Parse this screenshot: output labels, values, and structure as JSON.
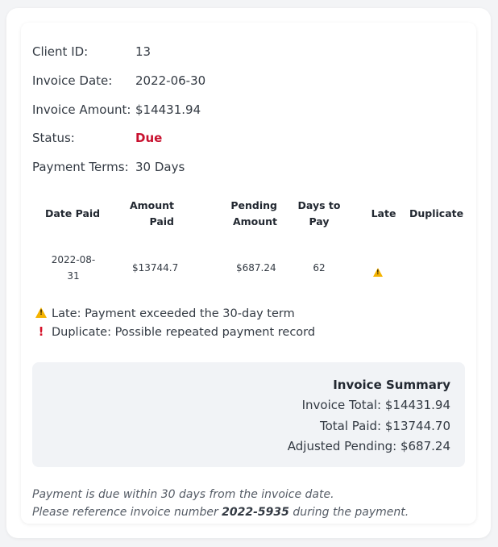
{
  "client": {
    "label": "Client ID:",
    "value": "13"
  },
  "invoice_date": {
    "label": "Invoice Date:",
    "value": "2022-06-30"
  },
  "invoice_amount": {
    "label": "Invoice Amount:",
    "value": "$14431.94"
  },
  "status": {
    "label": "Status:",
    "value": "Due",
    "color": "#c8102e"
  },
  "payment_terms": {
    "label": "Payment Terms:",
    "value": "30 Days"
  },
  "table": {
    "headers": {
      "date_paid": "Date Paid",
      "amount_paid_1": "Amount",
      "amount_paid_2": "Paid",
      "pending_1": "Pending",
      "pending_2": "Amount",
      "days_1": "Days to",
      "days_2": "Pay",
      "late": "Late",
      "duplicate": "Duplicate"
    },
    "rows": [
      {
        "date_paid_1": "2022-08-",
        "date_paid_2": "31",
        "amount_paid": "$13744.7",
        "pending_amount": "$687.24",
        "days_to_pay": "62",
        "late_icon": "warning-icon",
        "duplicate": ""
      }
    ]
  },
  "legend": {
    "late": {
      "icon": "warning-icon",
      "text": "Late: Payment exceeded the 30-day term"
    },
    "duplicate": {
      "icon": "exclamation-icon",
      "text": "Duplicate: Possible repeated payment record"
    }
  },
  "summary": {
    "title": "Invoice Summary",
    "invoice_total": "Invoice Total: $14431.94",
    "total_paid": "Total Paid: $13744.70",
    "adjusted_pending": "Adjusted Pending: $687.24"
  },
  "footer": {
    "line1": "Payment is due within 30 days from the invoice date.",
    "line2_prefix": "Please reference invoice number ",
    "invoice_number": "2022-5935",
    "line2_suffix": " during the payment."
  }
}
